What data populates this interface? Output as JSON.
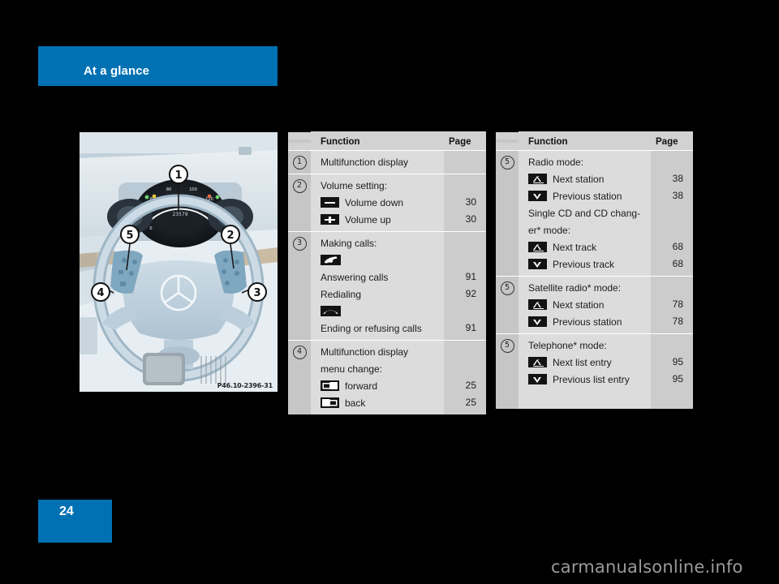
{
  "header": {
    "title": "At a glance",
    "banner_color": "#0071b3"
  },
  "footer": {
    "page_number": "24",
    "watermark": "carmanualsonline.info"
  },
  "figure": {
    "caption": "P46.10-2396-31",
    "callouts": [
      "1",
      "2",
      "3",
      "4",
      "5"
    ],
    "speedometer_reading": "23579"
  },
  "tables": [
    {
      "id": "table-left",
      "columns": {
        "function": "Function",
        "page": "Page"
      },
      "groups": [
        {
          "number": "1",
          "lines": [
            {
              "kind": "text",
              "label": "Multifunction display",
              "page": ""
            }
          ]
        },
        {
          "number": "2",
          "lines": [
            {
              "kind": "text",
              "label": "Volume setting:",
              "page": ""
            },
            {
              "kind": "icon",
              "icon": "minus-icon",
              "label": "Volume down",
              "page": "30"
            },
            {
              "kind": "icon",
              "icon": "plus-icon",
              "label": "Volume up",
              "page": "30"
            }
          ]
        },
        {
          "number": "3",
          "lines": [
            {
              "kind": "text",
              "label": "Making calls:",
              "page": ""
            },
            {
              "kind": "icon-above",
              "icon": "phone-answer-icon",
              "label": "Answering calls",
              "page": "91"
            },
            {
              "kind": "text",
              "label": "Redialing",
              "page": "92"
            },
            {
              "kind": "icon-above",
              "icon": "phone-end-icon",
              "label": "Ending or refusing calls",
              "page": "91"
            }
          ]
        },
        {
          "number": "4",
          "lines": [
            {
              "kind": "text2",
              "label": "Multifunction display",
              "label2": "menu change:",
              "page": ""
            },
            {
              "kind": "icon",
              "icon": "cards-forward-icon",
              "label": "forward",
              "page": "25"
            },
            {
              "kind": "icon",
              "icon": "cards-back-icon",
              "label": "back",
              "page": "25"
            }
          ]
        }
      ]
    },
    {
      "id": "table-right",
      "columns": {
        "function": "Function",
        "page": "Page"
      },
      "groups": [
        {
          "number": "5",
          "lines": [
            {
              "kind": "text",
              "label": "Radio mode:",
              "page": ""
            },
            {
              "kind": "icon",
              "icon": "triangle-up-icon",
              "label": "Next station",
              "page": "38"
            },
            {
              "kind": "icon",
              "icon": "triangle-down-icon",
              "label": "Previous station",
              "page": "38"
            },
            {
              "kind": "text2",
              "label": "Single CD and CD chang-",
              "label2": "er* mode:",
              "page": ""
            },
            {
              "kind": "icon",
              "icon": "triangle-up-icon",
              "label": "Next track",
              "page": "68"
            },
            {
              "kind": "icon",
              "icon": "triangle-down-icon",
              "label": "Previous track",
              "page": "68"
            }
          ]
        },
        {
          "number": "5",
          "lines": [
            {
              "kind": "text",
              "label": "Satellite radio* mode:",
              "page": ""
            },
            {
              "kind": "icon",
              "icon": "triangle-up-icon",
              "label": "Next station",
              "page": "78"
            },
            {
              "kind": "icon",
              "icon": "triangle-down-icon",
              "label": "Previous station",
              "page": "78"
            }
          ]
        },
        {
          "number": "5",
          "lines": [
            {
              "kind": "text",
              "label": "Telephone* mode:",
              "page": ""
            },
            {
              "kind": "icon",
              "icon": "triangle-up-icon",
              "label": "Next list entry",
              "page": "95"
            },
            {
              "kind": "icon",
              "icon": "triangle-down-icon",
              "label": "Previous list entry",
              "page": "95"
            }
          ]
        }
      ]
    }
  ]
}
